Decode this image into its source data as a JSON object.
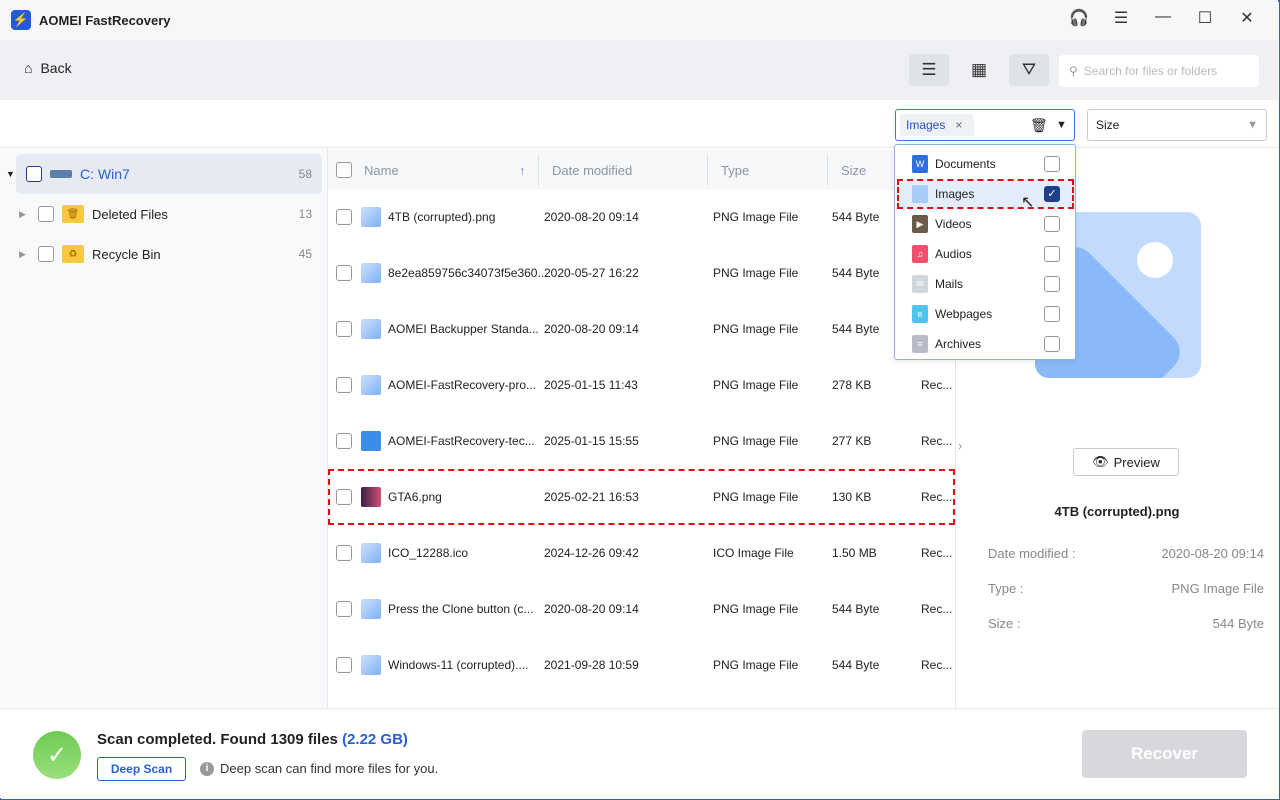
{
  "app": {
    "title": "AOMEI FastRecovery"
  },
  "toolbar": {
    "back_label": "Back",
    "search_placeholder": "Search for files or folders"
  },
  "filter": {
    "type_chip": "Images",
    "size_label": "Size"
  },
  "tree": [
    {
      "label": "C: Win7",
      "count": "58"
    },
    {
      "label": "Deleted Files",
      "count": "13"
    },
    {
      "label": "Recycle Bin",
      "count": "45"
    }
  ],
  "columns": {
    "name": "Name",
    "date": "Date modified",
    "type": "Type",
    "size": "Size"
  },
  "files": [
    {
      "name": "4TB (corrupted).png",
      "date": "2020-08-20 09:14",
      "type": "PNG Image File",
      "size": "544 Byte",
      "path": ""
    },
    {
      "name": "8e2ea859756c34073f5e360...",
      "date": "2020-05-27 16:22",
      "type": "PNG Image File",
      "size": "544 Byte",
      "path": ""
    },
    {
      "name": "AOMEI Backupper Standa...",
      "date": "2020-08-20 09:14",
      "type": "PNG Image File",
      "size": "544 Byte",
      "path": ""
    },
    {
      "name": "AOMEI-FastRecovery-pro...",
      "date": "2025-01-15 11:43",
      "type": "PNG Image File",
      "size": "278 KB",
      "path": "Rec..."
    },
    {
      "name": "AOMEI-FastRecovery-tec...",
      "date": "2025-01-15 15:55",
      "type": "PNG Image File",
      "size": "277 KB",
      "path": "Rec..."
    },
    {
      "name": "GTA6.png",
      "date": "2025-02-21 16:53",
      "type": "PNG Image File",
      "size": "130 KB",
      "path": "Rec..."
    },
    {
      "name": "ICO_12288.ico",
      "date": "2024-12-26 09:42",
      "type": "ICO Image File",
      "size": "1.50 MB",
      "path": "Rec..."
    },
    {
      "name": "Press the Clone button (c...",
      "date": "2020-08-20 09:14",
      "type": "PNG Image File",
      "size": "544 Byte",
      "path": "Rec..."
    },
    {
      "name": "Windows-11 (corrupted)....",
      "date": "2021-09-28 10:59",
      "type": "PNG Image File",
      "size": "544 Byte",
      "path": "Rec..."
    }
  ],
  "dropdown": [
    {
      "label": "Documents",
      "checked": false
    },
    {
      "label": "Images",
      "checked": true
    },
    {
      "label": "Videos",
      "checked": false
    },
    {
      "label": "Audios",
      "checked": false
    },
    {
      "label": "Mails",
      "checked": false
    },
    {
      "label": "Webpages",
      "checked": false
    },
    {
      "label": "Archives",
      "checked": false
    }
  ],
  "preview": {
    "button": "Preview",
    "filename": "4TB (corrupted).png",
    "meta": [
      {
        "k": "Date modified :",
        "v": "2020-08-20 09:14"
      },
      {
        "k": "Type :",
        "v": "PNG Image File"
      },
      {
        "k": "Size :",
        "v": "544 Byte"
      }
    ]
  },
  "status": {
    "text": "Scan completed. Found 1309 files",
    "size": "(2.22 GB)",
    "deep_scan": "Deep Scan",
    "tip": "Deep scan can find more files for you.",
    "recover": "Recover"
  }
}
